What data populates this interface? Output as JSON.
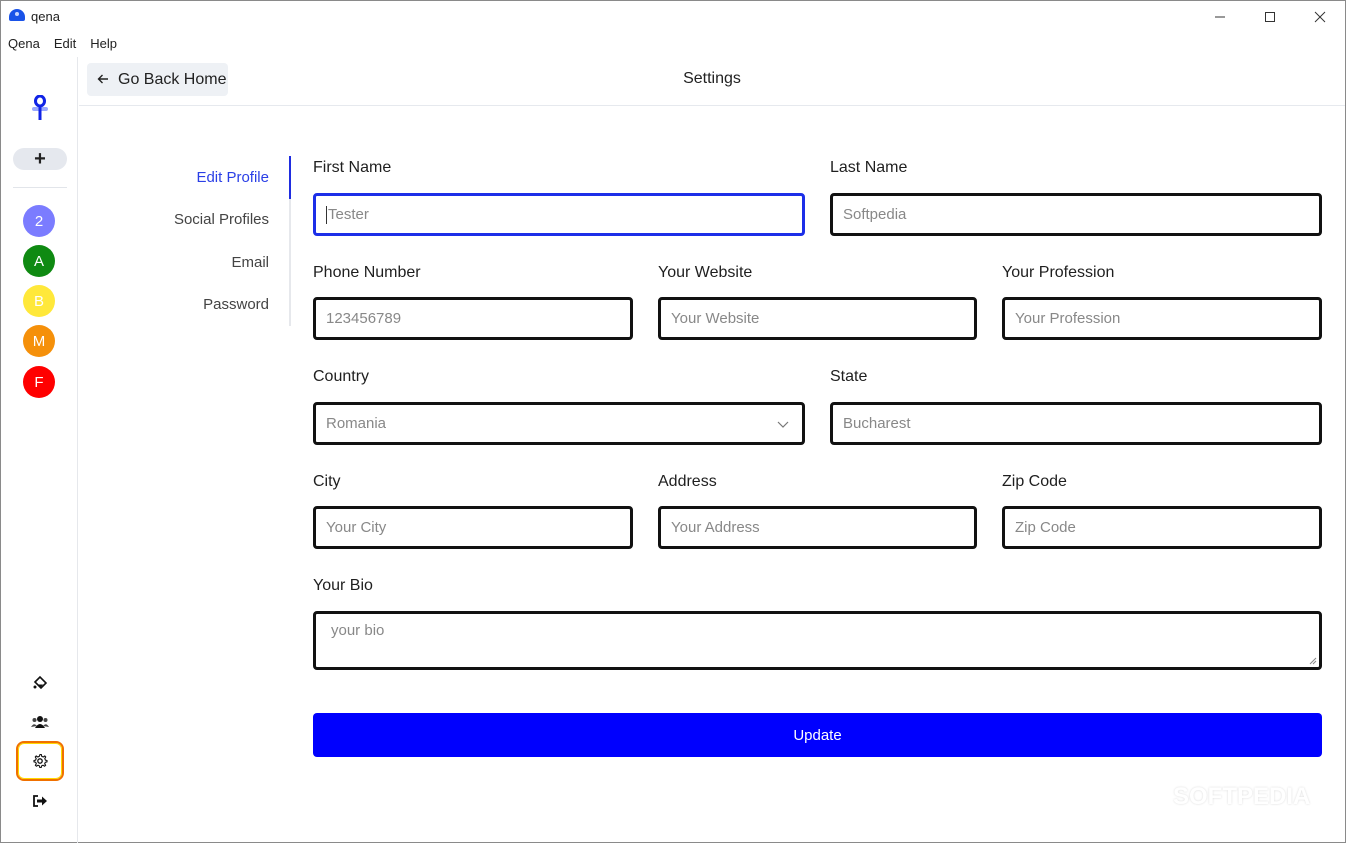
{
  "window": {
    "title": "qena",
    "controls": {
      "minimize": "—",
      "maximize": "☐",
      "close": "✕"
    }
  },
  "menubar": {
    "items": [
      "Qena",
      "Edit",
      "Help"
    ]
  },
  "sidebar": {
    "add_label": "+",
    "avatars": [
      {
        "label": "2",
        "color": "#7b7cff"
      },
      {
        "label": "A",
        "color": "#0f8a12"
      },
      {
        "label": "B",
        "color": "#ffe83a"
      },
      {
        "label": "M",
        "color": "#f5900a"
      },
      {
        "label": "F",
        "color": "#ff0000"
      }
    ],
    "bottom_icons": [
      "paint-bucket-icon",
      "users-icon",
      "gear-icon",
      "logout-icon"
    ],
    "active_icon": "gear-icon",
    "active_color": "#f07000"
  },
  "topbar": {
    "back_label": "Go Back Home",
    "title": "Settings"
  },
  "subnav": {
    "items": [
      "Edit Profile",
      "Social Profiles",
      "Email",
      "Password"
    ],
    "active": "Edit Profile"
  },
  "form": {
    "first_name": {
      "label": "First Name",
      "placeholder": "Tester"
    },
    "last_name": {
      "label": "Last Name",
      "placeholder": "Softpedia"
    },
    "phone": {
      "label": "Phone Number",
      "placeholder": "123456789"
    },
    "website": {
      "label": "Your Website",
      "placeholder": "Your Website"
    },
    "profession": {
      "label": "Your Profession",
      "placeholder": "Your Profession"
    },
    "country": {
      "label": "Country",
      "value": "Romania"
    },
    "state": {
      "label": "State",
      "placeholder": "Bucharest"
    },
    "city": {
      "label": "City",
      "placeholder": "Your City"
    },
    "address": {
      "label": "Address",
      "placeholder": "Your Address"
    },
    "zip": {
      "label": "Zip Code",
      "placeholder": "Zip Code"
    },
    "bio": {
      "label": "Your Bio",
      "placeholder": "your bio"
    },
    "submit_label": "Update",
    "accent": "#0000fe"
  },
  "watermark": "SOFTPEDIA"
}
